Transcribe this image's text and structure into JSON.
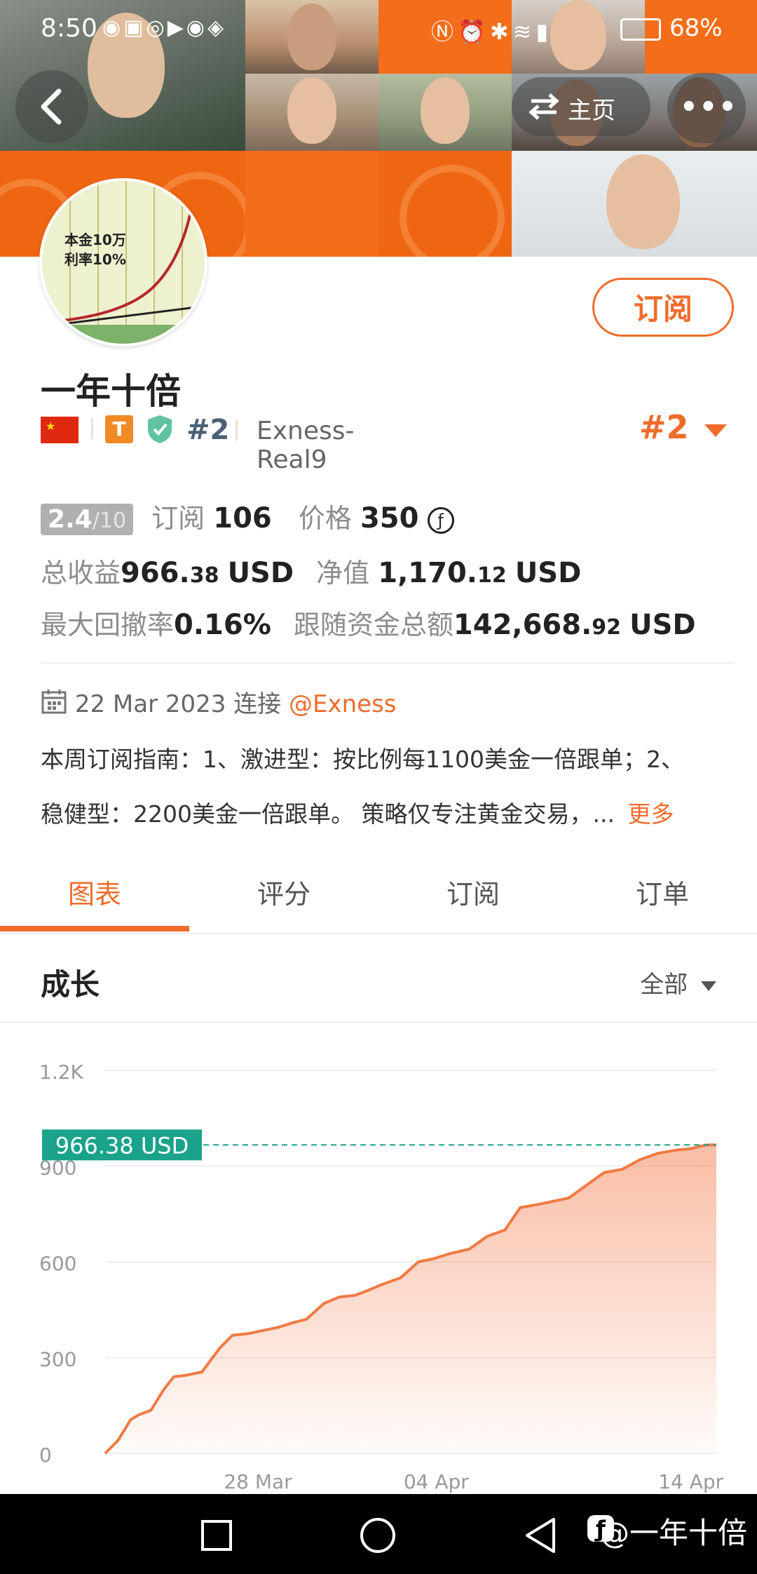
{
  "status_bar": {
    "time": "8:50",
    "battery": "68%"
  },
  "header": {
    "home_label": "主页",
    "more_label": "•••"
  },
  "avatar": {
    "line1": "本金10万",
    "line2": "利率10%"
  },
  "profile": {
    "name": "一年十倍",
    "flag_icon": "china-flag-icon",
    "badge_t": "T",
    "rank": "#2",
    "account": "Exness-Real9",
    "rank_right": "#2",
    "subscribe_label": "订阅"
  },
  "stats": {
    "score": "2.4",
    "score_max": "/10",
    "subs_label": "订阅",
    "subs_value": "106",
    "price_label": "价格",
    "price_value": "350",
    "total_profit_label": "总收益",
    "total_profit_int": "966.",
    "total_profit_dec": "38",
    "total_profit_unit": "USD",
    "equity_label": "净值",
    "equity_int": "1,170.",
    "equity_dec": "12",
    "equity_unit": "USD",
    "drawdown_label": "最大回撤率",
    "drawdown_value": "0.16%",
    "follow_label": "跟随资金总额",
    "follow_int": "142,668.",
    "follow_dec": "92",
    "follow_unit": "USD"
  },
  "connection": {
    "date": "22 Mar 2023",
    "text": "连接",
    "broker": "@Exness"
  },
  "description": {
    "line1": "本周订阅指南：1、激进型：按比例每1100美金一倍跟单；2、",
    "line2": "稳健型：2200美金一倍跟单。 策略仅专注黄金交易，...",
    "more": "更多"
  },
  "tabs": [
    {
      "label": "图表"
    },
    {
      "label": "评分"
    },
    {
      "label": "订阅"
    },
    {
      "label": "订单"
    }
  ],
  "growth": {
    "title": "成长",
    "filter": "全部"
  },
  "chart_data": {
    "type": "area",
    "title": "",
    "xlabel": "",
    "ylabel": "",
    "ylim": [
      0,
      1200
    ],
    "yticks": [
      0,
      300,
      600,
      900
    ],
    "ytick_labels": [
      "0",
      "300",
      "600",
      "900",
      "1.2K"
    ],
    "ytick_values": [
      0,
      300,
      600,
      900,
      1200
    ],
    "xticks": [
      {
        "label": "28 Mar",
        "x": 6
      },
      {
        "label": "04 Apr",
        "x": 13
      },
      {
        "label": "14 Apr",
        "x": 23
      }
    ],
    "xlim": [
      0,
      24
    ],
    "current_label": "966.38 USD",
    "current_value": 966.38,
    "series": [
      {
        "x": [
          0,
          0.5,
          1.0,
          1.3,
          1.8,
          2.3,
          2.7,
          3.2,
          3.8,
          4.5,
          5.0,
          5.6,
          6.2,
          6.8,
          7.4,
          7.9,
          8.6,
          9.2,
          9.8,
          10.3,
          10.9,
          11.6,
          12.3,
          12.9,
          13.5,
          14.3,
          15.0,
          15.7,
          16.3,
          17.0,
          17.6,
          18.2,
          18.9,
          19.6,
          20.3,
          21.0,
          21.7,
          22.4,
          23.0,
          23.6,
          24.0
        ],
        "y": [
          0,
          40,
          105,
          120,
          135,
          200,
          240,
          245,
          255,
          330,
          370,
          375,
          385,
          395,
          410,
          420,
          470,
          490,
          495,
          510,
          530,
          550,
          600,
          610,
          625,
          640,
          680,
          700,
          770,
          780,
          790,
          800,
          840,
          880,
          890,
          920,
          940,
          950,
          955,
          966.38,
          966.38
        ]
      }
    ]
  },
  "navbar": {
    "watermark": "@一年十倍"
  }
}
